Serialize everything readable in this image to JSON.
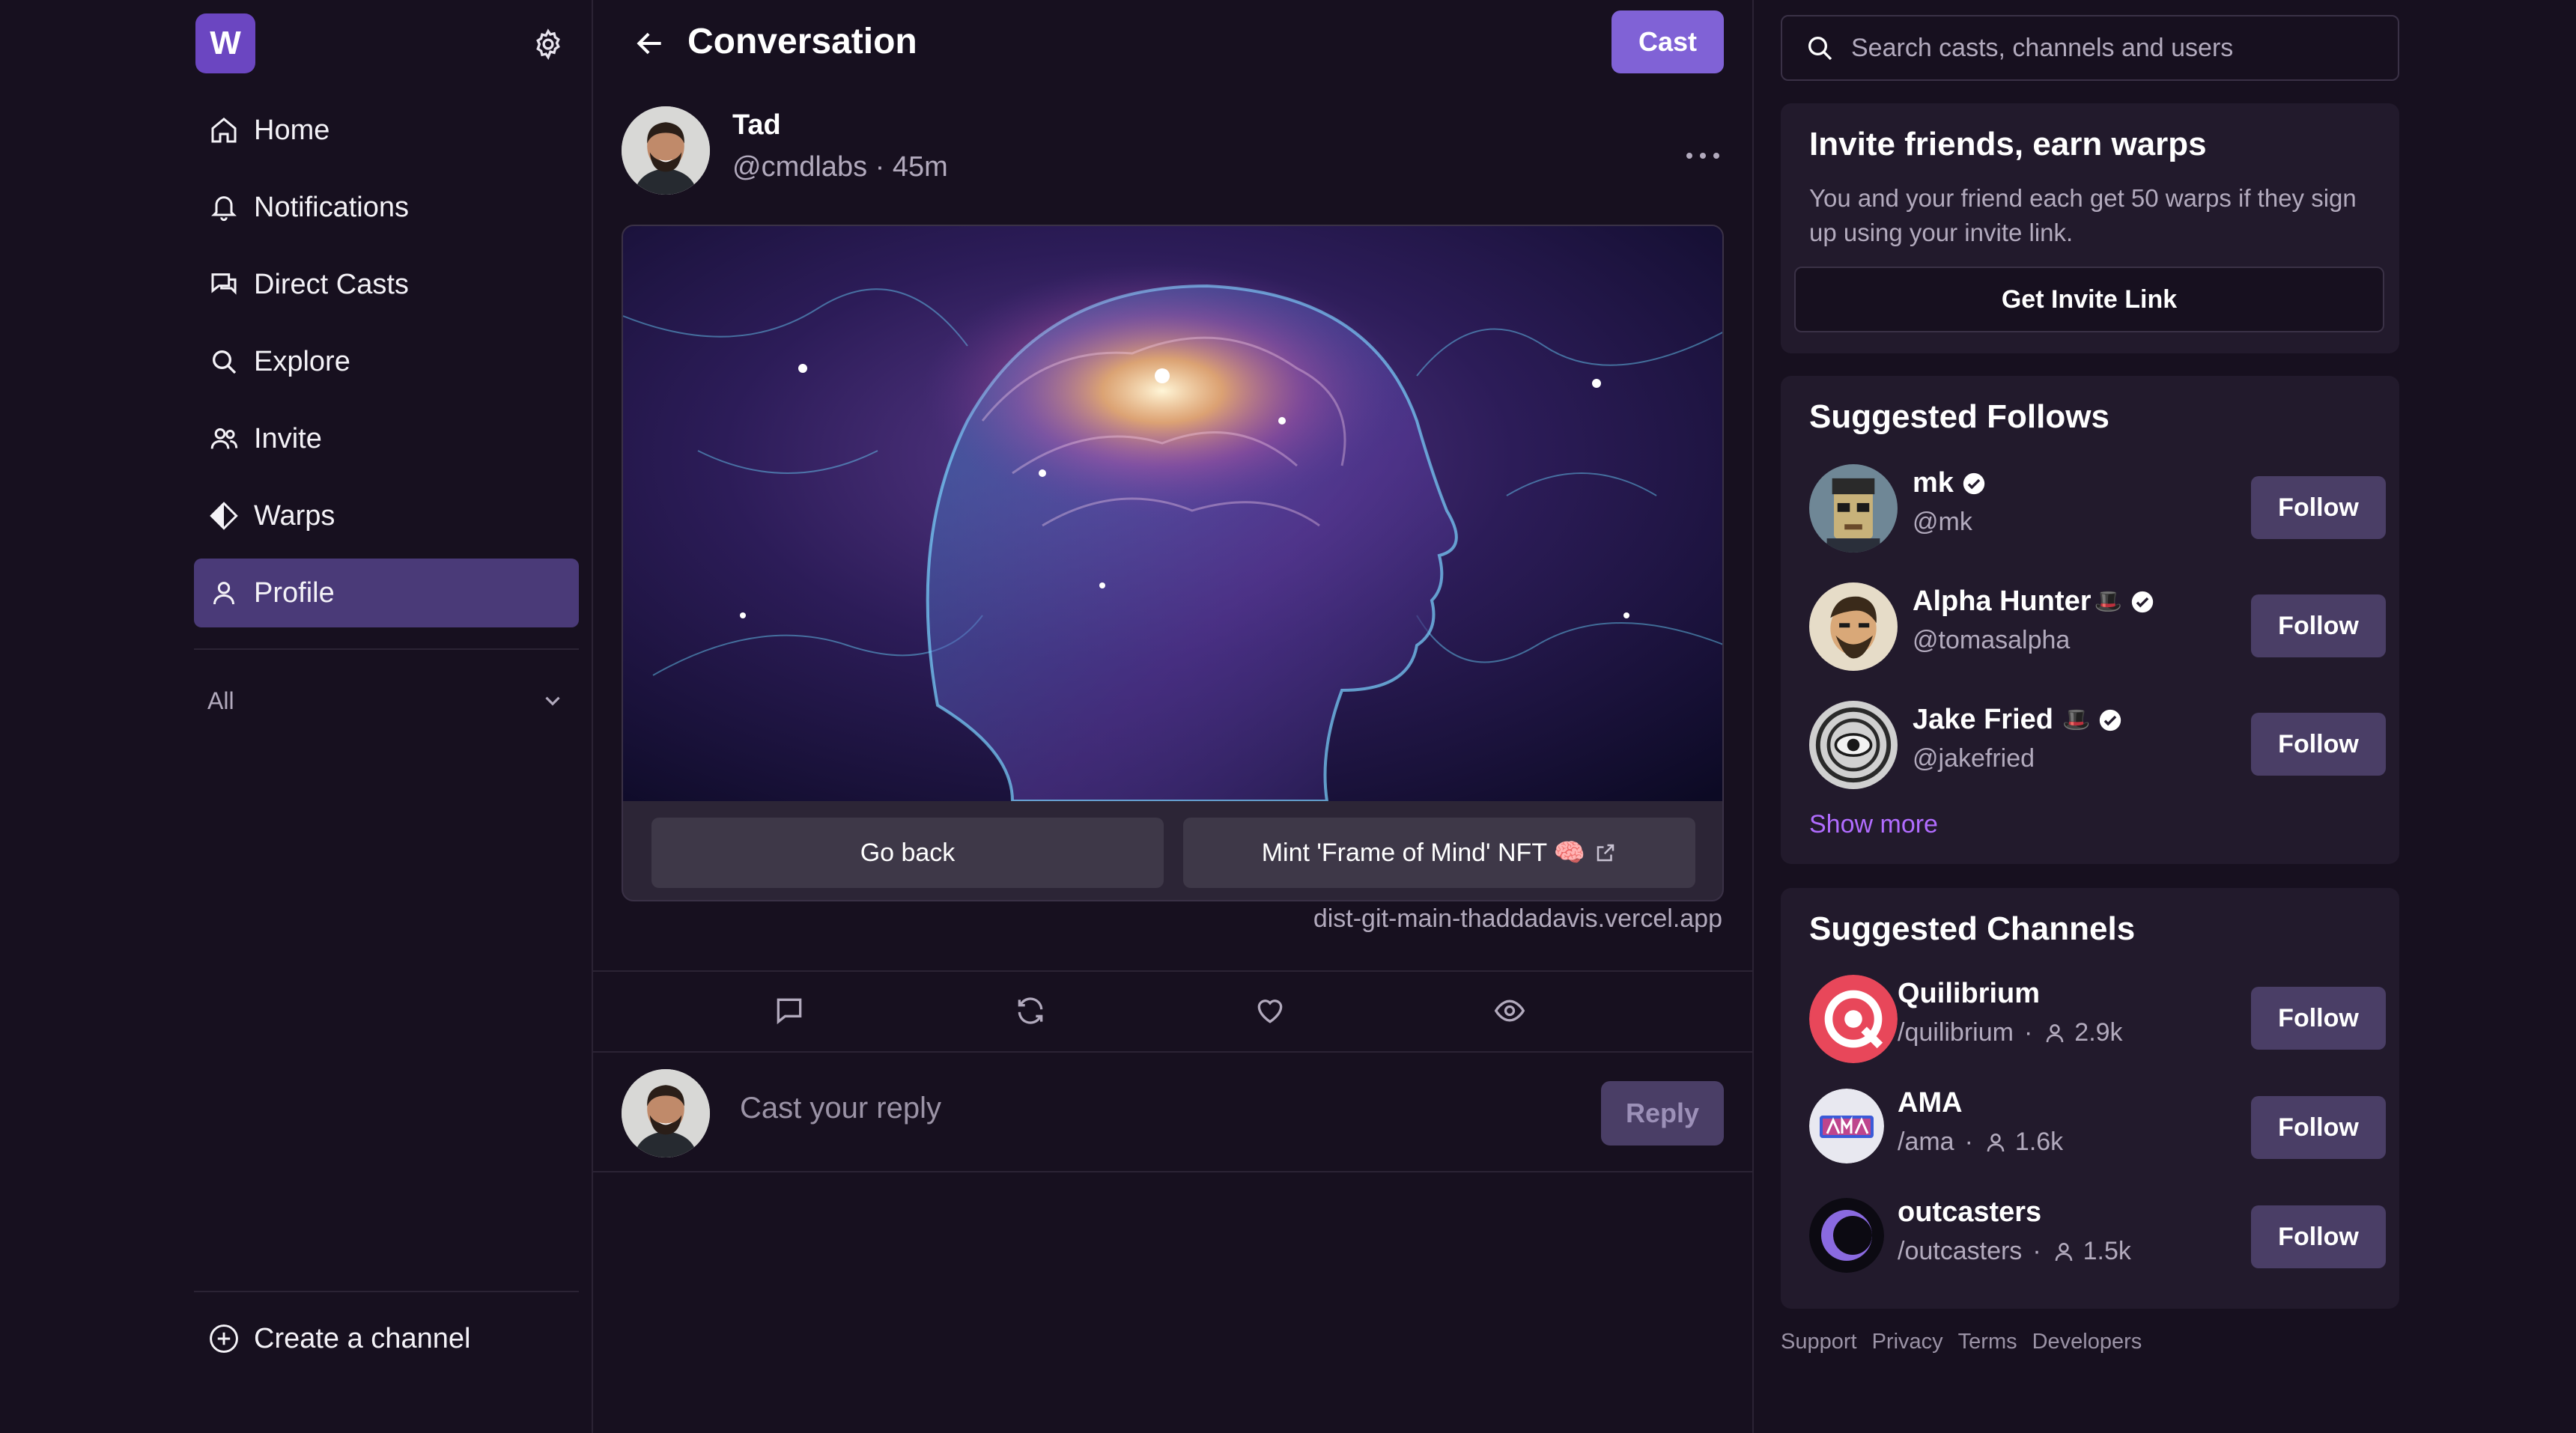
{
  "app": {
    "logo_letter": "W"
  },
  "sidebar": {
    "items": [
      {
        "label": "Home",
        "icon": "home-icon"
      },
      {
        "label": "Notifications",
        "icon": "bell-icon"
      },
      {
        "label": "Direct Casts",
        "icon": "chat-icon"
      },
      {
        "label": "Explore",
        "icon": "search-icon"
      },
      {
        "label": "Invite",
        "icon": "users-icon"
      },
      {
        "label": "Warps",
        "icon": "warps-icon"
      },
      {
        "label": "Profile",
        "icon": "user-icon",
        "active": true
      }
    ],
    "feed_filter": "All",
    "create_channel": "Create a channel"
  },
  "header": {
    "title": "Conversation",
    "cast_label": "Cast"
  },
  "cast": {
    "author_name": "Tad",
    "author_handle": "@cmdlabs",
    "separator": " · ",
    "age": "45m",
    "frame_buttons": [
      "Go back",
      "Mint 'Frame of Mind' NFT 🧠"
    ],
    "frame_domain": "dist-git-main-thaddadavis.vercel.app"
  },
  "reply": {
    "placeholder": "Cast your reply",
    "button_label": "Reply"
  },
  "search": {
    "placeholder": "Search casts, channels and users"
  },
  "invite": {
    "title": "Invite friends, earn warps",
    "text": "You and your friend each get 50 warps if they sign up using your invite link.",
    "button": "Get Invite Link"
  },
  "suggested_follows": {
    "title": "Suggested Follows",
    "users": [
      {
        "name": "mk",
        "handle": "@mk",
        "hat": "",
        "follow": "Follow"
      },
      {
        "name": "Alpha Hunter",
        "handle": "@tomasalpha",
        "hat": "🎩",
        "follow": "Follow"
      },
      {
        "name": "Jake Fried",
        "handle": "@jakefried",
        "hat": "🎩",
        "follow": "Follow"
      }
    ],
    "show_more": "Show more"
  },
  "suggested_channels": {
    "title": "Suggested Channels",
    "channels": [
      {
        "name": "Quilibrium",
        "handle": "/quilibrium",
        "members": "2.9k",
        "follow": "Follow"
      },
      {
        "name": "AMA",
        "handle": "/ama",
        "members": "1.6k",
        "follow": "Follow"
      },
      {
        "name": "outcasters",
        "handle": "/outcasters",
        "members": "1.5k",
        "follow": "Follow"
      }
    ]
  },
  "footer": {
    "links": [
      "Support",
      "Privacy",
      "Terms",
      "Developers"
    ]
  },
  "colors": {
    "background": "#17101f",
    "accent": "#8062d6",
    "active_nav": "#4a3a78",
    "link": "#b16cff"
  }
}
